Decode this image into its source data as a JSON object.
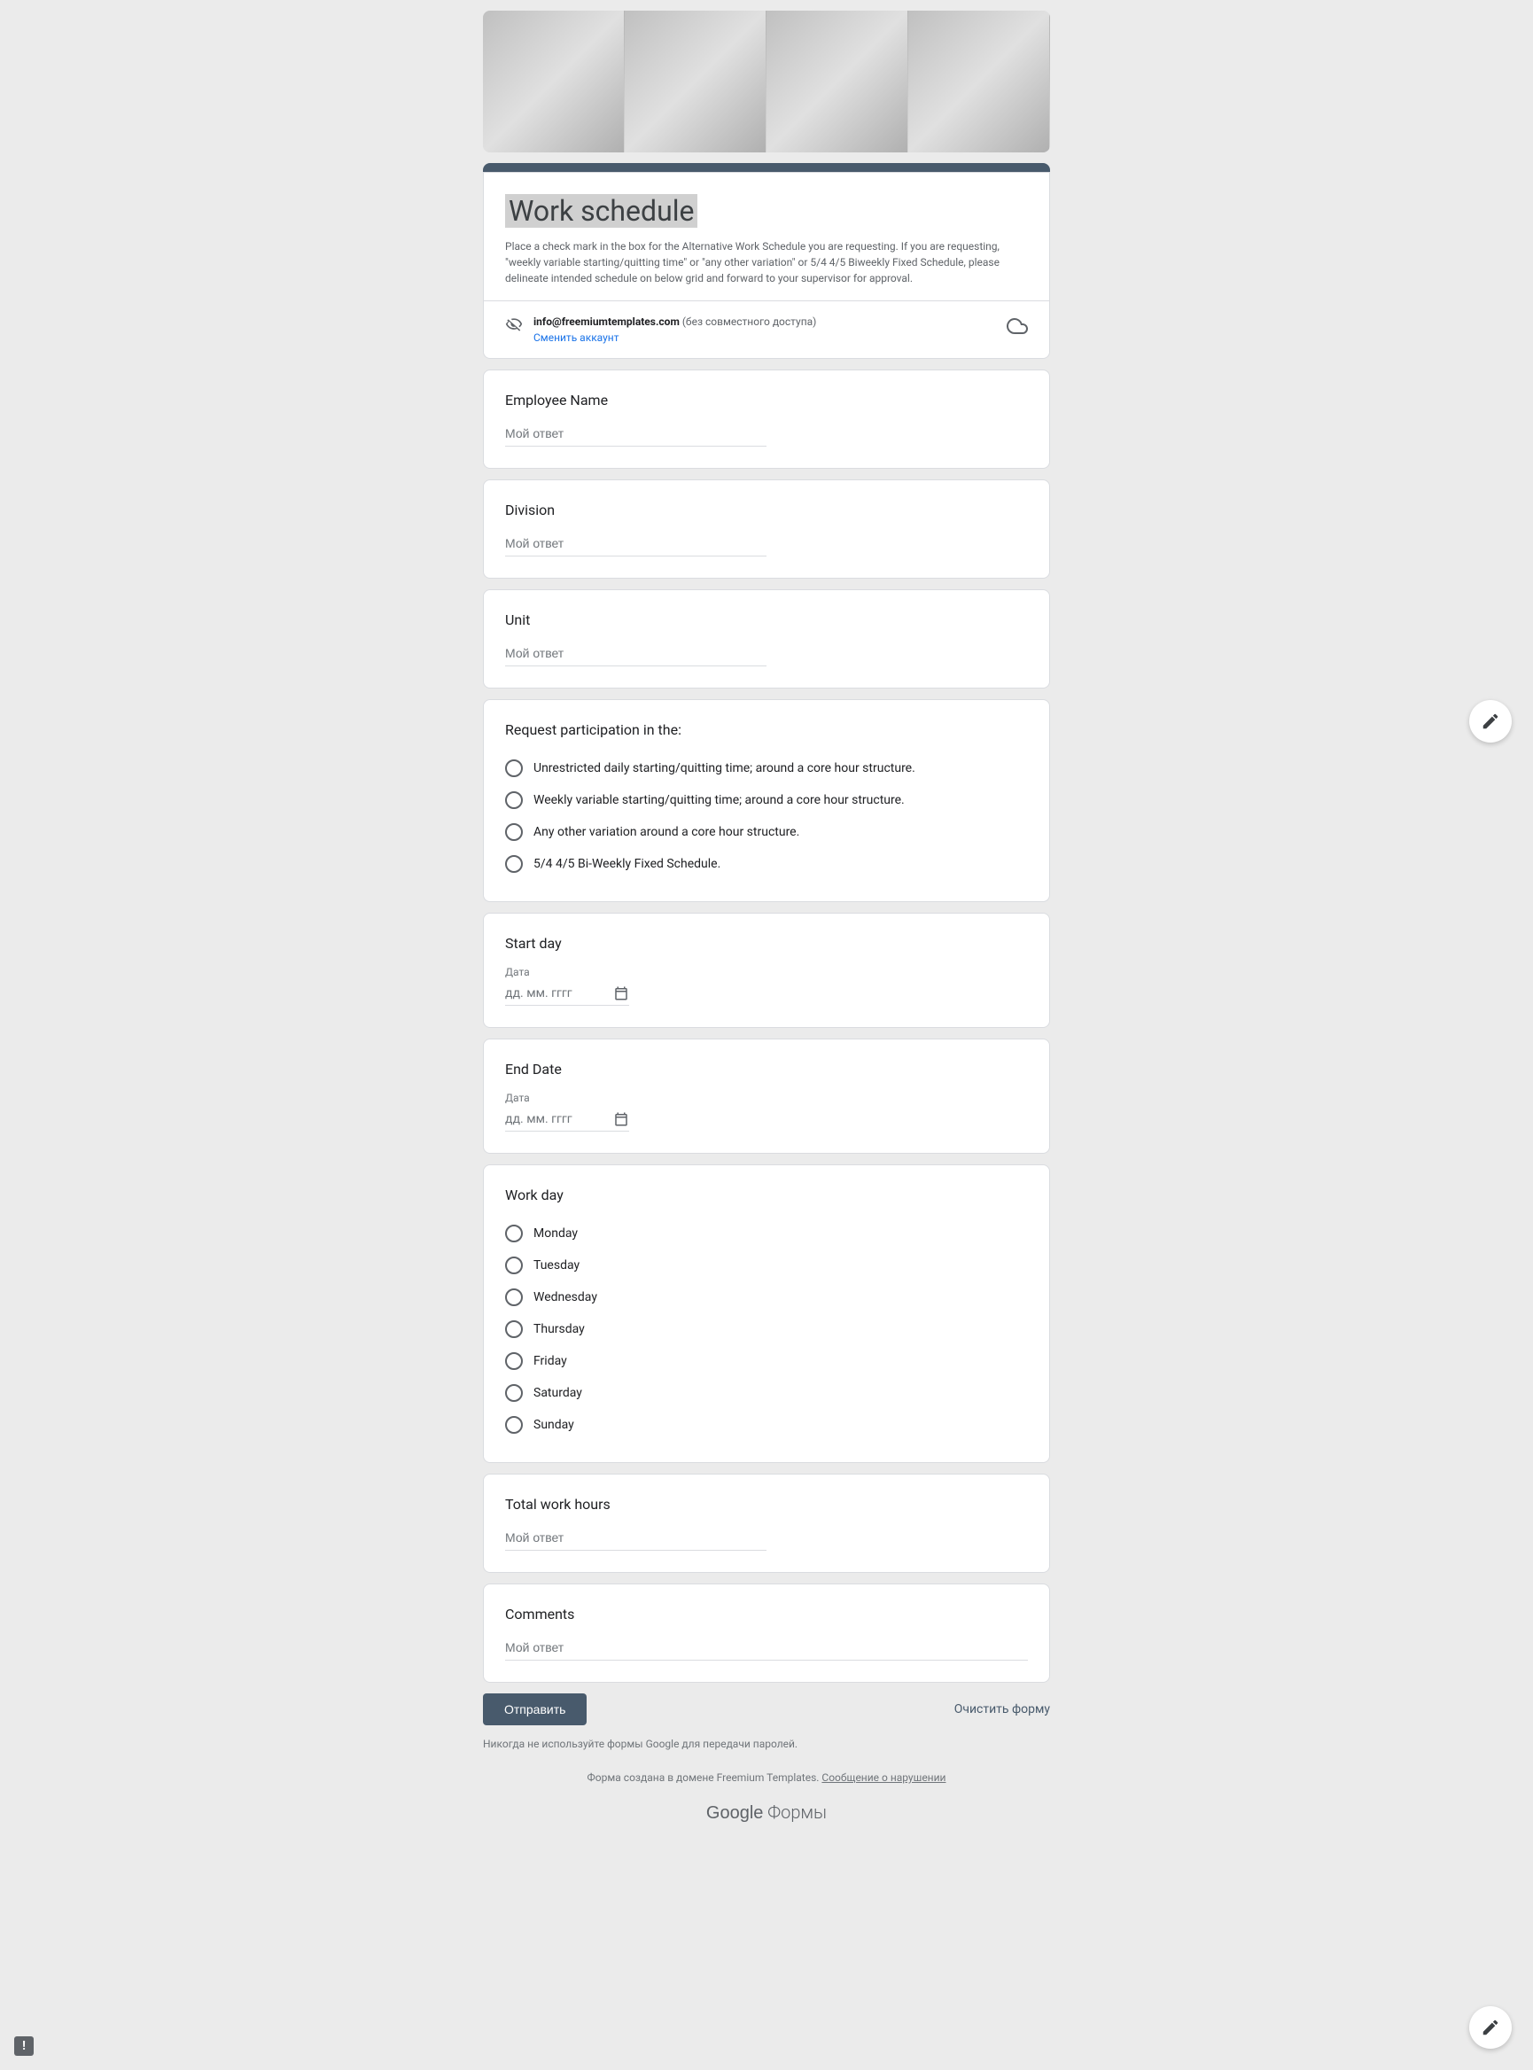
{
  "header": {
    "title": "Work schedule",
    "description": "Place a check mark in the box for the Alternative Work Schedule you are requesting.  If you are requesting, \"weekly variable starting/quitting time\" or \"any other variation\" or 5/4 4/5 Biweekly Fixed Schedule, please delineate intended schedule on below grid and forward to your supervisor for approval.",
    "account_email": "info@freemiumtemplates.com",
    "shared_note": "(без совместного доступа)",
    "switch_account": "Сменить аккаунт"
  },
  "placeholders": {
    "short_answer": "Мой ответ",
    "date": "дд. мм. гггг",
    "date_label": "Дата"
  },
  "questions": {
    "employee_name": {
      "title": "Employee Name"
    },
    "division": {
      "title": "Division"
    },
    "unit": {
      "title": "Unit"
    },
    "request": {
      "title": "Request participation in the:",
      "options": [
        "Unrestricted daily starting/quitting time; around a core hour structure.",
        "Weekly variable starting/quitting time; around a core hour structure.",
        "Any other variation around a core hour structure.",
        "5/4 4/5 Bi-Weekly Fixed Schedule."
      ]
    },
    "start_day": {
      "title": "Start day"
    },
    "end_date": {
      "title": "End Date"
    },
    "work_day": {
      "title": "Work day",
      "options": [
        "Monday",
        "Tuesday",
        "Wednesday",
        "Thursday",
        "Friday",
        "Saturday",
        "Sunday"
      ]
    },
    "total_hours": {
      "title": "Total work hours"
    },
    "comments": {
      "title": "Comments"
    }
  },
  "footer": {
    "submit": "Отправить",
    "clear": "Очистить форму",
    "password_note": "Никогда не используйте формы Google для передачи паролей.",
    "made_in_prefix": "Форма создана в домене Freemium Templates. ",
    "report_abuse": "Сообщение о нарушении",
    "logo_google": "Google",
    "logo_forms": " Формы"
  }
}
